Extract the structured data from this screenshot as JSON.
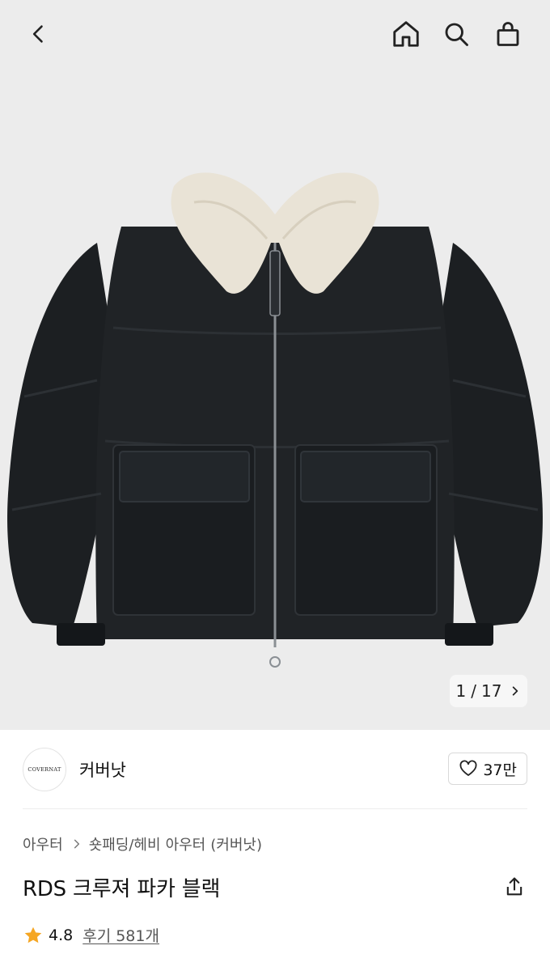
{
  "header": {
    "back_icon": "chevron-left-icon",
    "home_icon": "home-icon",
    "search_icon": "search-icon",
    "cart_icon": "shopping-bag-icon"
  },
  "gallery": {
    "current": "1",
    "separator": "/",
    "total": "17",
    "next_icon": "chevron-right-icon",
    "background_color": "#ececec"
  },
  "brand": {
    "logo_text": "COVERNAT",
    "name": "커버낫",
    "likes": "37만",
    "like_icon": "heart-outline-icon"
  },
  "breadcrumb": {
    "category": "아우터",
    "subcategory_parts": [
      "숏패딩/헤비",
      "아우터",
      "(커버낫)"
    ],
    "chevron_icon": "chevron-right-icon"
  },
  "product": {
    "title": "RDS 크루져 파카 블랙",
    "share_icon": "share-icon"
  },
  "rating": {
    "star_icon": "star-icon",
    "star_color": "#f5a623",
    "value": "4.8",
    "reviews_label": "후기 581개"
  }
}
